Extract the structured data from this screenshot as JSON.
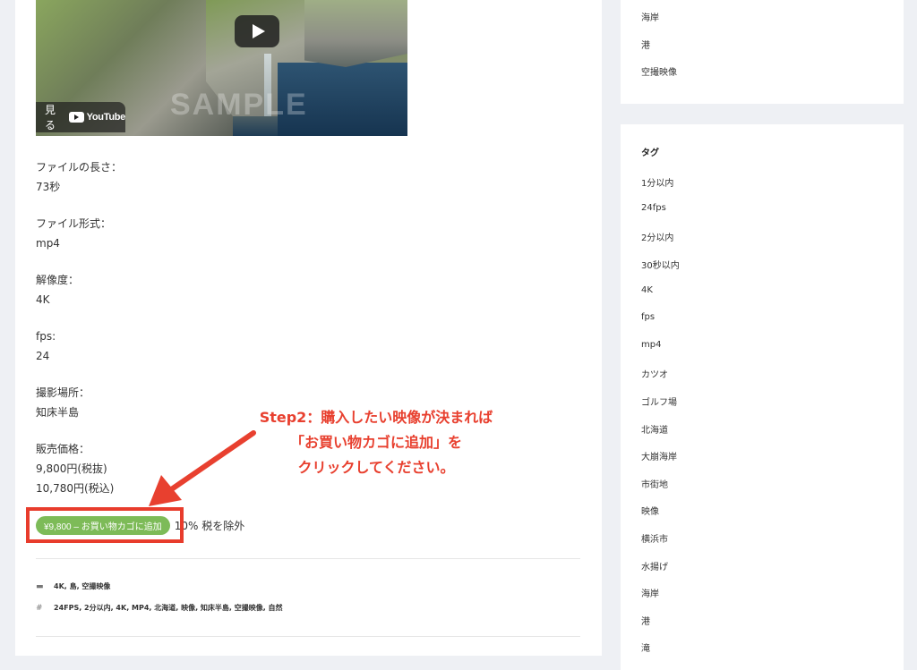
{
  "video": {
    "watch_label": "見る",
    "youtube_label": "YouTube",
    "watermark": "SAMPLE"
  },
  "details": [
    {
      "label": "ファイルの長さ：",
      "values": [
        "73秒"
      ]
    },
    {
      "label": "ファイル形式：",
      "values": [
        "mp4"
      ]
    },
    {
      "label": "解像度：",
      "values": [
        "4K"
      ]
    },
    {
      "label": "fps:",
      "values": [
        "24"
      ]
    },
    {
      "label": "撮影場所：",
      "values": [
        "知床半島"
      ]
    },
    {
      "label": "販売価格：",
      "values": [
        "9,800円(税抜)",
        "10,780円(税込)"
      ]
    }
  ],
  "cart": {
    "button_label": "¥9,800 – お買い物カゴに追加",
    "tax_note": "10% 税を除外"
  },
  "callout": {
    "line1": "Step2：購入したい映像が決まれば",
    "line2": "「お買い物カゴに追加」を",
    "line3": "クリックしてください。",
    "color": "#e8402f"
  },
  "post_meta": {
    "categories": "4K, 島, 空撮映像",
    "tags": "24FPS, 2分以内, 4K, MP4, 北海道, 映像, 知床半島, 空撮映像, 自然"
  },
  "sidebar": {
    "top_items": [
      "海岸",
      "港",
      "空撮映像"
    ],
    "tag_title": "タグ",
    "tags": [
      "1分以内",
      "24fps",
      "2分以内",
      "30秒以内",
      "4K",
      "fps",
      "mp4",
      "カツオ",
      "ゴルフ場",
      "北海道",
      "大崩海岸",
      "市街地",
      "映像",
      "横浜市",
      "水揚げ",
      "海岸",
      "港",
      "滝"
    ]
  },
  "colors": {
    "accent_green": "#7dbb58",
    "highlight_red": "#e83c2c",
    "page_bg": "#eef0f4"
  }
}
